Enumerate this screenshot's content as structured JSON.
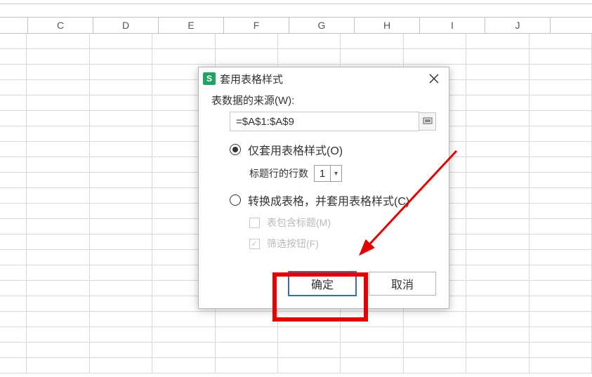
{
  "columns": [
    "C",
    "D",
    "E",
    "F",
    "G",
    "H",
    "I",
    "J"
  ],
  "dialog": {
    "title": "套用表格样式",
    "source_label": "表数据的来源(W):",
    "source_value": "=$A$1:$A$9",
    "radio_only_style": "仅套用表格样式(O)",
    "title_row_label": "标题行的行数",
    "title_row_value": "1",
    "radio_convert": "转换成表格，并套用表格样式(C)",
    "chk_has_header": "表包含标题(M)",
    "chk_filter_btn": "筛选按钮(F)",
    "ok": "确定",
    "cancel": "取消"
  }
}
